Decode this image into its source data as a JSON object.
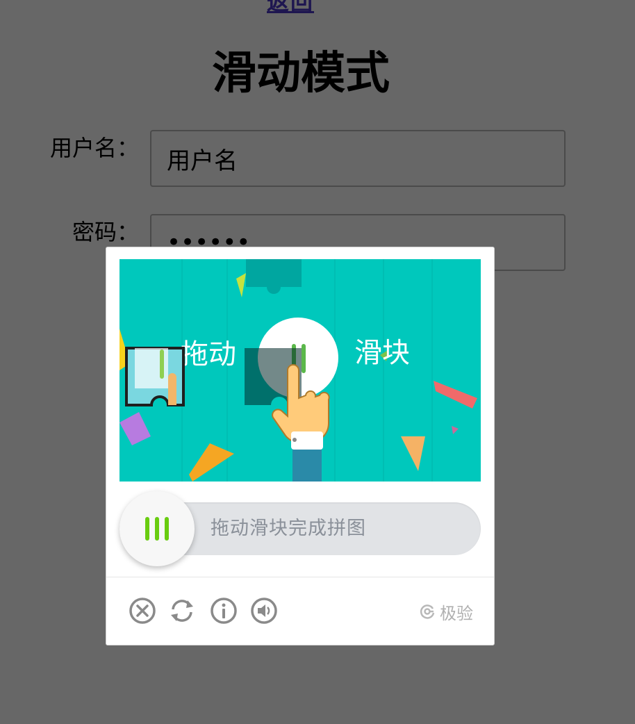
{
  "top_link": "返回",
  "title": "滑动模式",
  "form": {
    "username_label": "用户名：",
    "username_value": "用户名",
    "password_label": "密码：",
    "password_value": "••••••"
  },
  "captcha": {
    "image_text_left": "拖动",
    "image_text_right": "滑块",
    "slider_hint": "拖动滑块完成拼图",
    "brand_label": "极验",
    "icons": [
      "close-icon",
      "refresh-icon",
      "info-icon",
      "audio-icon",
      "geetest-logo-icon"
    ],
    "colors": {
      "accent_green": "#69cc10",
      "image_bg": "#00c8bc",
      "overlay_bg": "#676767"
    }
  }
}
